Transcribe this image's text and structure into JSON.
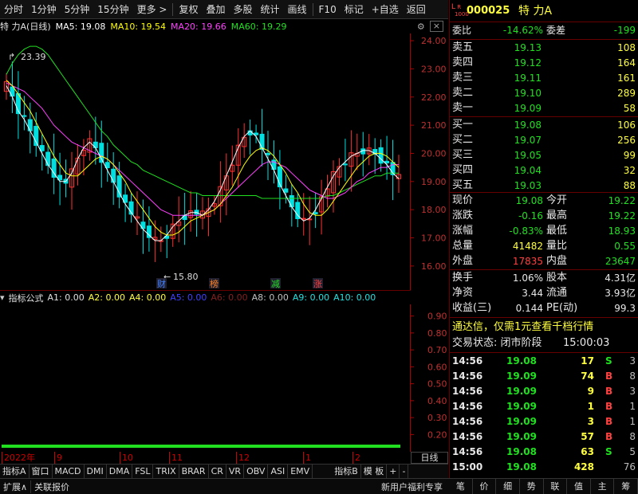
{
  "toolbar": {
    "items": [
      "分时",
      "1分钟",
      "5分钟",
      "15分钟",
      "更多 >",
      "复权",
      "叠加",
      "多股",
      "统计",
      "画线",
      "F10",
      "标记",
      "+自选",
      "返回"
    ]
  },
  "chart_info": {
    "title": "特 力A(日线)",
    "ma5": "MA5: 19.08",
    "ma10": "MA10: 19.54",
    "ma20": "MA20: 19.66",
    "ma60": "MA60: 19.29",
    "high_label": "23.39",
    "low_label": "15.80"
  },
  "colors": {
    "ma5": "#ffffff",
    "ma10": "#ffff00",
    "ma20": "#ff40ff",
    "ma60": "#20e020",
    "up": "#ff3030",
    "down": "#00e0e0"
  },
  "markers": [
    "财",
    "榜",
    "减",
    "涨"
  ],
  "indicator_bar": {
    "name": "指标公式",
    "items": [
      {
        "text": "A1: 0.00",
        "color": "#e0e0e0"
      },
      {
        "text": "A2: 0.00",
        "color": "#ffff40"
      },
      {
        "text": "A4: 0.00",
        "color": "#ffff40"
      },
      {
        "text": "A5: 0.00",
        "color": "#4040ff"
      },
      {
        "text": "A6: 0.00",
        "color": "#802020"
      },
      {
        "text": "A8: 0.00",
        "color": "#c0c0c0"
      },
      {
        "text": "A9: 0.00",
        "color": "#20e0e0"
      },
      {
        "text": "A10: 0.00",
        "color": "#20e0e0"
      }
    ]
  },
  "date_axis": [
    "2022年",
    "9",
    "10",
    "11",
    "12",
    "1",
    "2"
  ],
  "period_label": "日线",
  "tabs": [
    "指标A",
    "窗口",
    "MACD",
    "DMI",
    "DMA",
    "FSL",
    "TRIX",
    "BRAR",
    "CR",
    "VR",
    "OBV",
    "ASI",
    "EMV",
    "指标B",
    "模 板",
    "+",
    "-"
  ],
  "status_bar": {
    "left1": "扩展∧",
    "left2": "关联报价",
    "promo": "新用户福利专享",
    "tabs": [
      "笔",
      "价",
      "细",
      "势",
      "联",
      "值",
      "主",
      "筹"
    ]
  },
  "quote": {
    "code": "000025",
    "name": "特 力A",
    "webi_label": "委比",
    "webi_value": "-14.62%",
    "weicha_label": "委差",
    "weicha_value": "-199",
    "asks": [
      {
        "label": "卖五",
        "price": "19.13",
        "vol": "108"
      },
      {
        "label": "卖四",
        "price": "19.12",
        "vol": "164"
      },
      {
        "label": "卖三",
        "price": "19.11",
        "vol": "161"
      },
      {
        "label": "卖二",
        "price": "19.10",
        "vol": "289"
      },
      {
        "label": "卖一",
        "price": "19.09",
        "vol": "58"
      }
    ],
    "bids": [
      {
        "label": "买一",
        "price": "19.08",
        "vol": "106"
      },
      {
        "label": "买二",
        "price": "19.07",
        "vol": "256"
      },
      {
        "label": "买三",
        "price": "19.05",
        "vol": "99"
      },
      {
        "label": "买四",
        "price": "19.04",
        "vol": "32"
      },
      {
        "label": "买五",
        "price": "19.03",
        "vol": "88"
      }
    ],
    "stats": [
      {
        "l1": "现价",
        "v1": "19.08",
        "c1": "green",
        "l2": "今开",
        "v2": "19.22",
        "c2": "green"
      },
      {
        "l1": "涨跌",
        "v1": "-0.16",
        "c1": "green",
        "l2": "最高",
        "v2": "19.22",
        "c2": "green"
      },
      {
        "l1": "涨幅",
        "v1": "-0.83%",
        "c1": "green",
        "l2": "最低",
        "v2": "18.93",
        "c2": "green"
      },
      {
        "l1": "总量",
        "v1": "41482",
        "c1": "yellow",
        "l2": "量比",
        "v2": "0.55",
        "c2": "green"
      },
      {
        "l1": "外盘",
        "v1": "17835",
        "c1": "red",
        "l2": "内盘",
        "v2": "23647",
        "c2": "green"
      }
    ],
    "fund": [
      {
        "l1": "换手",
        "v1": "1.06%",
        "l2": "股本",
        "v2": "4.31亿"
      },
      {
        "l1": "净资",
        "v1": "3.44",
        "l2": "流通",
        "v2": "3.93亿"
      },
      {
        "l1": "收益(三)",
        "v1": "0.144",
        "l2": "PE(动)",
        "v2": "99.3"
      }
    ],
    "promo": "通达信，仅需1元查看千档行情",
    "trade_status": "交易状态: 闭市阶段",
    "trade_time": "15:00:03",
    "ticks": [
      {
        "t": "14:56",
        "p": "19.08",
        "v": "17",
        "s": "S",
        "n": "3"
      },
      {
        "t": "14:56",
        "p": "19.09",
        "v": "74",
        "s": "B",
        "n": "8"
      },
      {
        "t": "14:56",
        "p": "19.09",
        "v": "9",
        "s": "B",
        "n": "3"
      },
      {
        "t": "14:56",
        "p": "19.09",
        "v": "1",
        "s": "B",
        "n": "1"
      },
      {
        "t": "14:56",
        "p": "19.09",
        "v": "3",
        "s": "B",
        "n": "1"
      },
      {
        "t": "14:56",
        "p": "19.09",
        "v": "57",
        "s": "B",
        "n": "8"
      },
      {
        "t": "14:56",
        "p": "19.08",
        "v": "63",
        "s": "S",
        "n": "5"
      },
      {
        "t": "15:00",
        "p": "19.08",
        "v": "428",
        "s": "",
        "n": "76"
      }
    ]
  },
  "chart_data": {
    "type": "candlestick",
    "y_ticks": [
      "24.00",
      "23.00",
      "22.00",
      "21.00",
      "20.00",
      "19.00",
      "18.00",
      "17.00",
      "16.00"
    ],
    "ylim": [
      15.6,
      24.2
    ],
    "sub_ticks": [
      "0.90",
      "0.80",
      "0.70",
      "0.60",
      "0.50",
      "0.40",
      "0.30",
      "0.20"
    ],
    "sub_ylim": [
      0.15,
      0.95
    ],
    "ma5": [
      22.4,
      22.0,
      21.5,
      21.2,
      20.8,
      20.4,
      20.0,
      19.6,
      19.3,
      19.0,
      19.0,
      19.3,
      19.8,
      20.2,
      20.4,
      20.2,
      19.8,
      19.4,
      19.0,
      18.6,
      18.2,
      17.9,
      17.6,
      17.3,
      17.1,
      16.9,
      16.9,
      17.1,
      17.4,
      17.6,
      17.8,
      17.9,
      17.9,
      17.8,
      18.0,
      18.3,
      18.7,
      19.2,
      19.7,
      20.2,
      20.6,
      20.8,
      20.6,
      20.2,
      19.8,
      19.4,
      18.9,
      18.5,
      18.1,
      17.8,
      17.6,
      17.7,
      18.0,
      18.4,
      18.8,
      19.2,
      19.5,
      19.7,
      19.9,
      20.0,
      20.1,
      20.1,
      20.0,
      19.8,
      19.6,
      19.3,
      19.1
    ],
    "ma10": [
      22.6,
      22.4,
      22.1,
      21.8,
      21.5,
      21.1,
      20.7,
      20.3,
      19.9,
      19.6,
      19.3,
      19.2,
      19.2,
      19.4,
      19.6,
      19.8,
      19.9,
      19.8,
      19.6,
      19.3,
      19.0,
      18.6,
      18.3,
      18.0,
      17.7,
      17.4,
      17.2,
      17.1,
      17.1,
      17.2,
      17.4,
      17.6,
      17.7,
      17.8,
      17.9,
      18.0,
      18.2,
      18.5,
      18.8,
      19.2,
      19.6,
      19.9,
      20.1,
      20.2,
      20.1,
      19.9,
      19.6,
      19.3,
      18.9,
      18.6,
      18.2,
      17.9,
      17.8,
      17.8,
      18.0,
      18.3,
      18.6,
      18.9,
      19.2,
      19.5,
      19.7,
      19.9,
      20.0,
      20.0,
      19.9,
      19.7,
      19.5
    ],
    "ma20": [
      22.5,
      22.4,
      22.3,
      22.2,
      22.0,
      21.8,
      21.6,
      21.3,
      21.0,
      20.8,
      20.6,
      20.4,
      20.3,
      20.2,
      20.1,
      20.0,
      19.9,
      19.8,
      19.6,
      19.4,
      19.2,
      19.0,
      18.8,
      18.6,
      18.4,
      18.2,
      18.0,
      17.9,
      17.8,
      17.8,
      17.8,
      17.8,
      17.8,
      17.8,
      17.9,
      18.0,
      18.2,
      18.4,
      18.6,
      18.8,
      19.0,
      19.2,
      19.4,
      19.6,
      19.7,
      19.7,
      19.6,
      19.5,
      19.3,
      19.1,
      18.9,
      18.7,
      18.6,
      18.5,
      18.4,
      18.4,
      18.5,
      18.6,
      18.8,
      19.0,
      19.1,
      19.3,
      19.4,
      19.5,
      19.5,
      19.6,
      19.6
    ],
    "ma60": [
      22.8,
      23.2,
      23.5,
      23.7,
      23.8,
      23.8,
      23.7,
      23.5,
      23.2,
      22.9,
      22.6,
      22.3,
      22.0,
      21.7,
      21.4,
      21.1,
      20.8,
      20.6,
      20.3,
      20.1,
      19.9,
      19.7,
      19.6,
      19.4,
      19.3,
      19.2,
      19.1,
      19.0,
      18.9,
      18.8,
      18.7,
      18.6,
      18.6,
      18.5,
      18.5,
      18.5,
      18.5,
      18.5,
      18.5,
      18.5,
      18.5,
      18.5,
      18.5,
      18.4,
      18.4,
      18.4,
      18.4,
      18.4,
      18.4,
      18.4,
      18.4,
      18.4,
      18.4,
      18.4,
      18.5,
      18.5,
      18.6,
      18.7,
      18.8,
      18.9,
      19.0,
      19.1,
      19.2,
      19.2,
      19.3,
      19.3,
      19.3
    ]
  }
}
